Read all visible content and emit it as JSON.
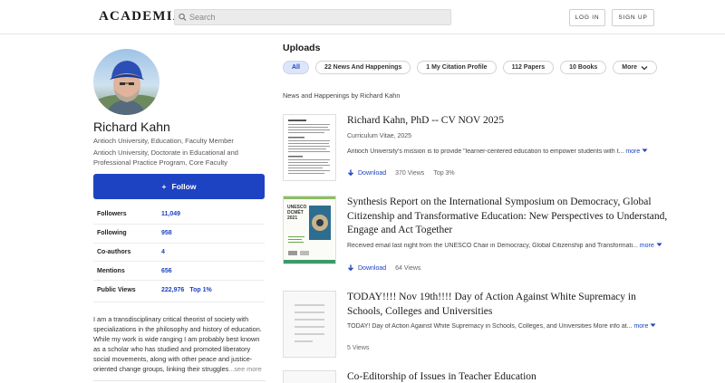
{
  "header": {
    "logo": "ACADEMIA",
    "search_placeholder": "Search",
    "login_label": "LOG IN",
    "signup_label": "SIGN UP"
  },
  "profile": {
    "name": "Richard Kahn",
    "affiliation1": "Antioch University, Education, Faculty Member",
    "affiliation2": "Antioch University, Doctorate in Educational and Professional Practice Program, Core Faculty",
    "follow_label": "Follow",
    "stats": [
      {
        "label": "Followers",
        "value": "11,049"
      },
      {
        "label": "Following",
        "value": "958"
      },
      {
        "label": "Co-authors",
        "value": "4"
      },
      {
        "label": "Mentions",
        "value": "656"
      },
      {
        "label": "Public Views",
        "value": "222,976",
        "extra": "Top 1%"
      }
    ],
    "bio": "I am a transdisciplinary critical theorist of society with specializations in the philosophy and history of education. While my work is wide ranging I am probably best known as a scholar who has studied and promoted liberatory social movements, along with other peace and justice-oriented change groups, linking their struggles",
    "see_more": "...see more"
  },
  "uploads": {
    "title": "Uploads",
    "tabs": [
      {
        "label": "All",
        "active": true
      },
      {
        "label": "22 News And Happenings"
      },
      {
        "label": "1 My Citation Profile"
      },
      {
        "label": "112 Papers"
      },
      {
        "label": "10 Books"
      },
      {
        "label": "More"
      }
    ],
    "section_title": "News and Happenings by Richard Kahn",
    "items": [
      {
        "title": "Richard Kahn, PhD -- CV NOV 2025",
        "meta": "Curriculum Vitae, 2025",
        "desc": "Antioch University's mission is to provide \"learner-centered education to empower students with t...",
        "more": "more",
        "download": "Download",
        "views": "370 Views",
        "rank": "Top 3%"
      },
      {
        "title": "Synthesis Report on the International Symposium on Democracy, Global Citizenship and Transformative Education: New Perspectives to Understand, Engage and Act Together",
        "desc": "Received email last night from the UNESCO Chair in Democracy, Global Citizenship and Transformati...",
        "more": "more",
        "download": "Download",
        "views": "64 Views",
        "thumb_text": "UNESCO DCMÉT 2021"
      },
      {
        "title": "TODAY!!!! Nov 19th!!!! Day of Action Against White Supremacy in Schools, Colleges and Universities",
        "desc": "TODAY! Day of Action Against White Supremacy in Schools, Colleges, and Universities More info at...",
        "more": "more",
        "views": "5 Views"
      },
      {
        "title": "Co-Editorship of Issues in Teacher Education"
      }
    ]
  }
}
